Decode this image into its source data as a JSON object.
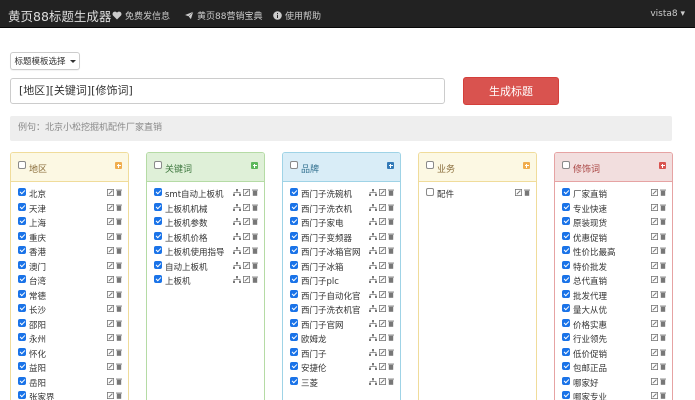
{
  "nav": {
    "brand": "黄页88标题生成器",
    "items": [
      {
        "label": "免费发信息",
        "icon": "heart-icon"
      },
      {
        "label": "黄页88营销宝典",
        "icon": "send-icon"
      },
      {
        "label": "使用帮助",
        "icon": "info-icon"
      }
    ],
    "user": "vista8"
  },
  "template_button": "标题模板选择",
  "title_input": "[地区][关键词][修饰词]",
  "generate_button": "生成标题",
  "example": "例句：北京小松挖掘机配件厂家直销",
  "colors": {
    "orange_border": "#f0dc9b",
    "orange_bg": "#fcf8e3",
    "orange_text": "#8a6d3b",
    "orange_add": "#f0ad4e",
    "green_border": "#b5dba5",
    "green_bg": "#dff0d8",
    "green_text": "#3c763d",
    "green_add": "#5cb85c",
    "blue_border": "#9fd3e6",
    "blue_bg": "#d9edf7",
    "blue_text": "#31708f",
    "blue_add": "#337ab7",
    "red_border": "#e6a3a3",
    "red_bg": "#f2dede",
    "red_text": "#a94442",
    "red_add": "#d9534f"
  },
  "panels": [
    {
      "title": "地区",
      "theme": "orange",
      "header_checked": false,
      "actions": "edit-delete",
      "items": [
        {
          "label": "北京",
          "checked": true
        },
        {
          "label": "天津",
          "checked": true
        },
        {
          "label": "上海",
          "checked": true
        },
        {
          "label": "重庆",
          "checked": true
        },
        {
          "label": "香港",
          "checked": true
        },
        {
          "label": "澳门",
          "checked": true
        },
        {
          "label": "台湾",
          "checked": true
        },
        {
          "label": "常德",
          "checked": true
        },
        {
          "label": "长沙",
          "checked": true
        },
        {
          "label": "邵阳",
          "checked": true
        },
        {
          "label": "永州",
          "checked": true
        },
        {
          "label": "怀化",
          "checked": true
        },
        {
          "label": "益阳",
          "checked": true
        },
        {
          "label": "岳阳",
          "checked": true
        },
        {
          "label": "张家界",
          "checked": true
        }
      ]
    },
    {
      "title": "关键词",
      "theme": "green",
      "header_checked": false,
      "actions": "tree-edit-delete",
      "items": [
        {
          "label": "smt自动上板机",
          "checked": true
        },
        {
          "label": "上板机机械",
          "checked": true
        },
        {
          "label": "上板机参数",
          "checked": true
        },
        {
          "label": "上板机价格",
          "checked": true
        },
        {
          "label": "上板机使用指导",
          "checked": true
        },
        {
          "label": "自动上板机",
          "checked": true
        },
        {
          "label": "上板机",
          "checked": true
        }
      ]
    },
    {
      "title": "品牌",
      "theme": "blue",
      "header_checked": false,
      "actions": "tree-edit-delete",
      "items": [
        {
          "label": "西门子洗碗机",
          "checked": true
        },
        {
          "label": "西门子洗衣机",
          "checked": true
        },
        {
          "label": "西门子家电",
          "checked": true
        },
        {
          "label": "西门子变频器",
          "checked": true
        },
        {
          "label": "西门子冰箱官网",
          "checked": true
        },
        {
          "label": "西门子冰箱",
          "checked": true
        },
        {
          "label": "西门子plc",
          "checked": true
        },
        {
          "label": "西门子自动化官",
          "checked": true
        },
        {
          "label": "西门子洗衣机官",
          "checked": true
        },
        {
          "label": "西门子官网",
          "checked": true
        },
        {
          "label": "欧姆龙",
          "checked": true
        },
        {
          "label": "西门子",
          "checked": true
        },
        {
          "label": "安捷伦",
          "checked": true
        },
        {
          "label": "三菱",
          "checked": true
        }
      ]
    },
    {
      "title": "业务",
      "theme": "orange",
      "header_checked": false,
      "actions": "edit-delete",
      "items": [
        {
          "label": "配件",
          "checked": false
        }
      ]
    },
    {
      "title": "修饰词",
      "theme": "red",
      "header_checked": false,
      "actions": "edit-delete",
      "items": [
        {
          "label": "厂家直销",
          "checked": true
        },
        {
          "label": "专业快速",
          "checked": true
        },
        {
          "label": "原装现货",
          "checked": true
        },
        {
          "label": "优惠促销",
          "checked": true
        },
        {
          "label": "性价比最高",
          "checked": true
        },
        {
          "label": "特价批发",
          "checked": true
        },
        {
          "label": "总代直销",
          "checked": true
        },
        {
          "label": "批发代理",
          "checked": true
        },
        {
          "label": "量大从优",
          "checked": true
        },
        {
          "label": "价格实惠",
          "checked": true
        },
        {
          "label": "行业领先",
          "checked": true
        },
        {
          "label": "低价促销",
          "checked": true
        },
        {
          "label": "包邮正品",
          "checked": true
        },
        {
          "label": "哪家好",
          "checked": true
        },
        {
          "label": "哪家专业",
          "checked": true
        }
      ]
    }
  ]
}
